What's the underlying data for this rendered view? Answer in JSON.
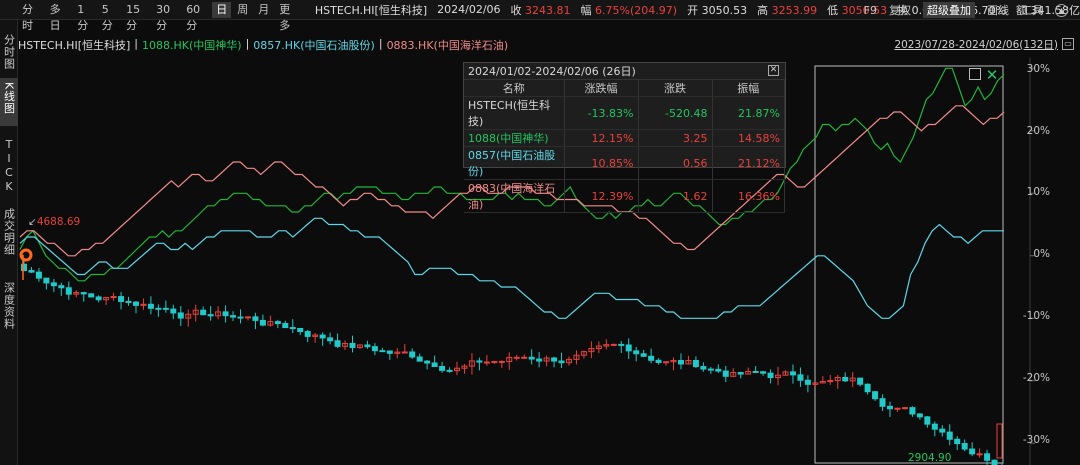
{
  "toolbar": {
    "timeframes": [
      "分时",
      "多日",
      "1分",
      "5分",
      "15分",
      "30分",
      "60分",
      "日",
      "周",
      "月",
      "更多"
    ],
    "active": "日",
    "quote": {
      "symbol": "HSTECH.HI[恒生科技]",
      "date": "2024/02/06",
      "close_label": "收",
      "close": "3243.81",
      "chg_label": "幅",
      "chg": "6.75%(204.97)",
      "open_label": "开",
      "open": "3050.53",
      "high_label": "高",
      "high": "3253.99",
      "low_label": "低",
      "low": "3050.53",
      "turnover_label": "换",
      "turnover": "0.00%",
      "amp_label": "振",
      "amp": "6.70%",
      "amount_label": "额",
      "amount": "341.58亿"
    },
    "tools": [
      "F9",
      "复权",
      "超级叠加",
      "画线",
      "工具"
    ],
    "tools_highlight": "超级叠加"
  },
  "legend": {
    "main": "HSTECH.HI[恒生科技]",
    "sep": "|",
    "s1": "1088.HK(中国神华)",
    "s2": "0857.HK(中国石油股份)",
    "s3": "0883.HK(中国海洋石油)"
  },
  "range": {
    "text": "2023/07/28-2024/02/06(132日)"
  },
  "sidebar": {
    "items": [
      "分时图",
      "K线图",
      "TICK",
      "成交明细",
      "深度资料"
    ],
    "active": "K线图"
  },
  "popup": {
    "title": "2024/01/02-2024/02/06 (26日)",
    "headers": [
      "名称",
      "涨跌幅",
      "涨跌",
      "振幅"
    ],
    "rows": [
      {
        "name": "HSTECH(恒生科技)",
        "pct": "-13.83%",
        "chg": "-520.48",
        "amp": "21.87%",
        "color": "#d8d8d8",
        "pct_color": "#22c55e",
        "chg_color": "#22c55e"
      },
      {
        "name": "1088(中国神华)",
        "pct": "12.15%",
        "chg": "3.25",
        "amp": "14.58%",
        "color": "#22c55e",
        "pct_color": "#e8413c",
        "chg_color": "#e8413c"
      },
      {
        "name": "0857(中国石油股份)",
        "pct": "10.85%",
        "chg": "0.56",
        "amp": "21.12%",
        "color": "#5fd7e8",
        "pct_color": "#e8413c",
        "chg_color": "#e8413c"
      },
      {
        "name": "0883(中国海洋石油)",
        "pct": "12.39%",
        "chg": "1.62",
        "amp": "16.36%",
        "color": "#f08a8a",
        "pct_color": "#e8413c",
        "chg_color": "#e8413c"
      }
    ]
  },
  "axis": {
    "ylabels": [
      "30%",
      "20%",
      "10%",
      "0%",
      "-10%",
      "-20%",
      "-30%"
    ]
  },
  "annotations": {
    "high": "4688.69",
    "low": "2904.90"
  },
  "colors": {
    "up": "#e8413c",
    "down": "#22c9c9",
    "green_line": "#22b53a",
    "cyan_line": "#5fd7e8",
    "pink_line": "#f08a8a"
  },
  "chart_data": {
    "type": "line",
    "x_range": [
      "2023/07/28",
      "2024/02/06"
    ],
    "ylim": [
      -33,
      31
    ],
    "ytick_labels": [
      "30%",
      "20%",
      "10%",
      "0%",
      "-10%",
      "-20%",
      "-30%"
    ],
    "series": [
      {
        "name": "1088.HK(中国神华)",
        "color": "#22b53a",
        "values": [
          1,
          3,
          4,
          2,
          0,
          -1,
          -2,
          -2,
          -3,
          -4,
          -4,
          -3,
          -3,
          -3,
          -2,
          -2,
          -1,
          0,
          1,
          2,
          3,
          3,
          4,
          3,
          4,
          4,
          5,
          6,
          7,
          8,
          8,
          9,
          9,
          10,
          10,
          10,
          9,
          9,
          8,
          8,
          8,
          8,
          7,
          7,
          8,
          8,
          9,
          10,
          10,
          9,
          10,
          10,
          11,
          11,
          11,
          11,
          10,
          10,
          10,
          9,
          9,
          10,
          10,
          10,
          11,
          11,
          10,
          10,
          10,
          9,
          9,
          9,
          9,
          9,
          10,
          10,
          9,
          10,
          9,
          9,
          9,
          8,
          8,
          9,
          10,
          11,
          9,
          8,
          7,
          6,
          6,
          7,
          6,
          7,
          7,
          8,
          8,
          9,
          8,
          8,
          9,
          10,
          10,
          9,
          8,
          8,
          7,
          6,
          5,
          5,
          6,
          6,
          7,
          7,
          8,
          9,
          9,
          10,
          12,
          14,
          15,
          17,
          18,
          19,
          21,
          21,
          20,
          21,
          21,
          22,
          21,
          20,
          18,
          17,
          18,
          16,
          15,
          17,
          19,
          22,
          25,
          26,
          28,
          30,
          30,
          27,
          24,
          25,
          27,
          25,
          26,
          28,
          29
        ]
      },
      {
        "name": "0857.HK(中国石油股份)",
        "color": "#5fd7e8",
        "values": [
          2,
          3,
          3,
          2,
          1,
          0,
          -1,
          -2,
          -3,
          -3,
          -2,
          -1,
          -1,
          -2,
          -2,
          -2,
          -1,
          0,
          1,
          2,
          2,
          1,
          1,
          2,
          1,
          2,
          3,
          3,
          4,
          4,
          4,
          4,
          4,
          3,
          3,
          3,
          4,
          4,
          3,
          4,
          5,
          6,
          6,
          5,
          5,
          5,
          4,
          4,
          3,
          3,
          3,
          2,
          1,
          0,
          -1,
          -3,
          -3,
          -2,
          -2,
          -2,
          -2,
          -3,
          -3,
          -3,
          -4,
          -4,
          -4,
          -5,
          -5,
          -5,
          -6,
          -7,
          -8,
          -9,
          -9,
          -10,
          -10,
          -9,
          -8,
          -7,
          -6,
          -6,
          -6,
          -7,
          -7,
          -7,
          -7,
          -8,
          -8,
          -8,
          -9,
          -9,
          -10,
          -10,
          -10,
          -10,
          -10,
          -10,
          -9,
          -9,
          -8,
          -8,
          -8,
          -8,
          -7,
          -6,
          -5,
          -4,
          -3,
          -2,
          -1,
          0,
          0,
          -1,
          -2,
          -3,
          -4,
          -6,
          -8,
          -9,
          -10,
          -10,
          -9,
          -8,
          -3,
          -1,
          2,
          4,
          5,
          4,
          3,
          3,
          2,
          3,
          4,
          4,
          4,
          4
        ]
      },
      {
        "name": "0883.HK(中国海洋石油)",
        "color": "#f08a8a",
        "values": [
          3,
          4,
          4,
          3,
          2,
          2,
          1,
          0,
          0,
          1,
          1,
          2,
          2,
          3,
          4,
          5,
          6,
          7,
          8,
          9,
          10,
          11,
          12,
          11,
          12,
          13,
          13,
          12,
          12,
          13,
          14,
          15,
          15,
          14,
          14,
          13,
          14,
          15,
          15,
          14,
          13,
          13,
          12,
          11,
          11,
          10,
          9,
          8,
          9,
          9,
          10,
          10,
          9,
          9,
          8,
          8,
          7,
          7,
          7,
          7,
          6,
          7,
          8,
          9,
          10,
          10,
          11,
          11,
          10,
          10,
          10,
          11,
          11,
          11,
          11,
          10,
          10,
          10,
          9,
          9,
          9,
          9,
          8,
          8,
          8,
          8,
          8,
          7,
          7,
          7,
          6,
          6,
          5,
          4,
          3,
          2,
          2,
          1,
          1,
          2,
          3,
          4,
          5,
          6,
          7,
          8,
          9,
          10,
          11,
          12,
          13,
          13,
          12,
          11,
          11,
          12,
          13,
          14,
          15,
          16,
          17,
          18,
          19,
          20,
          21,
          22,
          22,
          23,
          23,
          22,
          21,
          20,
          21,
          21,
          22,
          23,
          24,
          24,
          23,
          22,
          21,
          22,
          22,
          23
        ]
      }
    ]
  }
}
